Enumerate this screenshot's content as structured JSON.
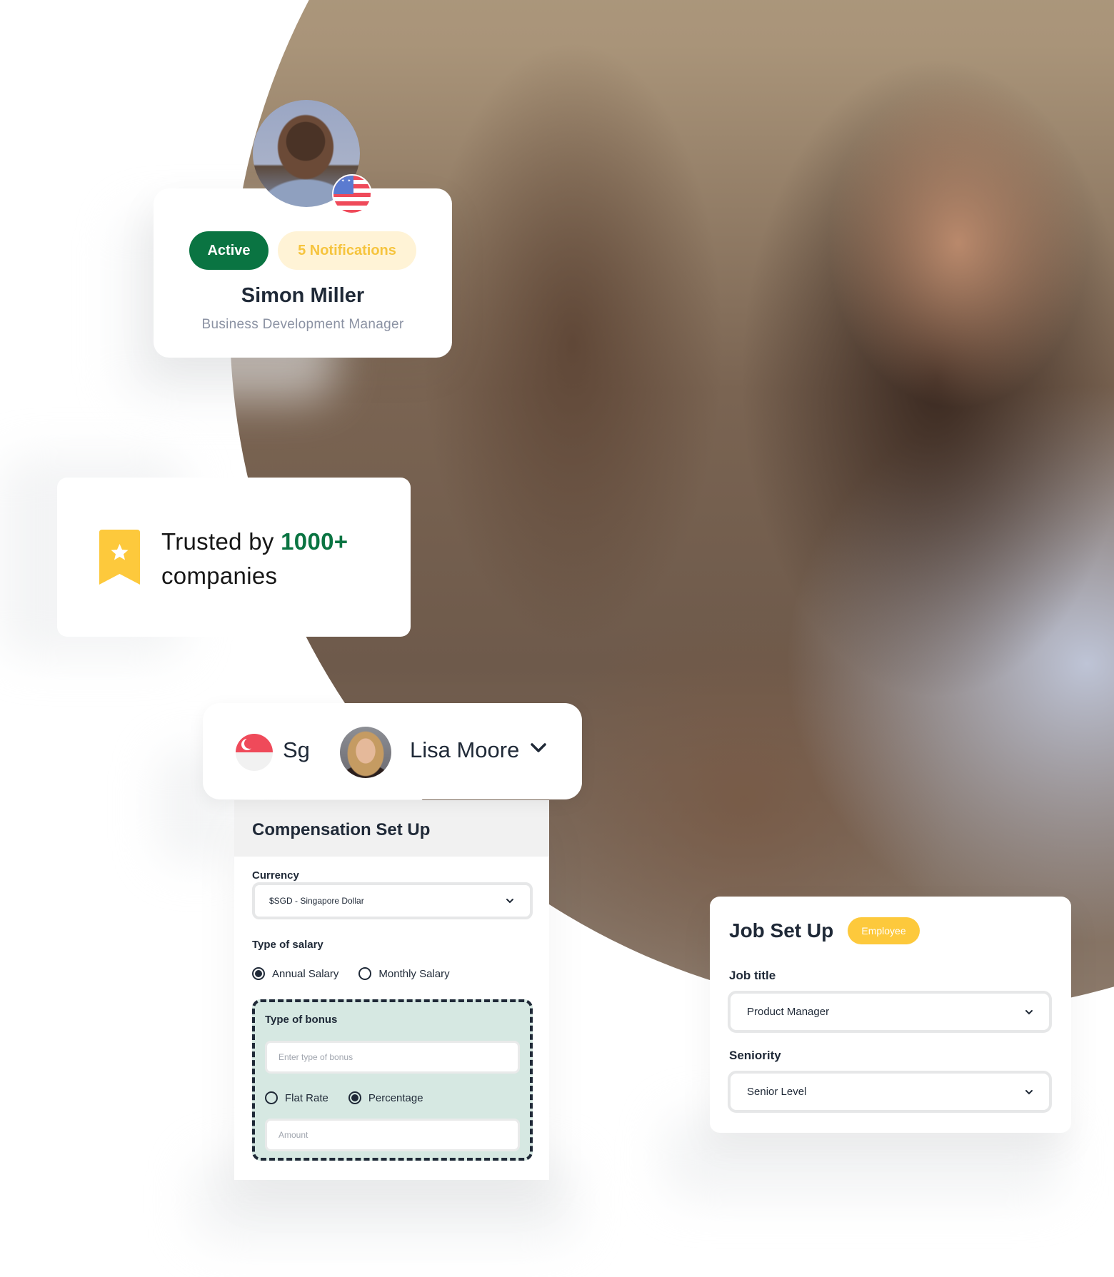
{
  "background": {
    "photo_description": "Smiling woman with glasses and a light sweater working at a laptop"
  },
  "profile_card": {
    "avatar_alt": "Simon Miller avatar",
    "flag": "United States",
    "status_badge": "Active",
    "notifications_badge": "5 Notifications",
    "name": "Simon Miller",
    "role": "Business Development Manager",
    "colors": {
      "active": "#0a7442",
      "notifications_bg": "#fff3d6",
      "notifications_text": "#f6c43e"
    }
  },
  "trusted_card": {
    "icon": "bookmark-star-icon",
    "prefix": "Trusted by ",
    "count": "1000+",
    "suffix": "companies",
    "colors": {
      "count": "#0a7442",
      "icon": "#fdc93c"
    }
  },
  "user_switcher": {
    "country_flag": "Singapore",
    "country_code": "Sg",
    "user_name": "Lisa Moore",
    "dropdown_icon": "chevron-down-icon"
  },
  "compensation": {
    "title": "Compensation Set Up",
    "currency": {
      "label": "Currency",
      "value": "$SGD - Singapore Dollar"
    },
    "salary_type": {
      "label": "Type of salary",
      "options": [
        {
          "label": "Annual Salary",
          "selected": true
        },
        {
          "label": "Monthly Salary",
          "selected": false
        }
      ]
    },
    "bonus": {
      "label": "Type of bonus",
      "type_placeholder": "Enter type of bonus",
      "rate_options": [
        {
          "label": "Flat Rate",
          "selected": false
        },
        {
          "label": "Percentage",
          "selected": true
        }
      ],
      "amount_placeholder": "Amount",
      "colors": {
        "box_bg": "#d6e8e2",
        "dash": "#1f2937"
      }
    }
  },
  "job_setup": {
    "title": "Job Set Up",
    "badge": "Employee",
    "job_title": {
      "label": "Job title",
      "value": "Product Manager"
    },
    "seniority": {
      "label": "Seniority",
      "value": "Senior Level"
    },
    "colors": {
      "badge": "#fdc93c"
    }
  }
}
